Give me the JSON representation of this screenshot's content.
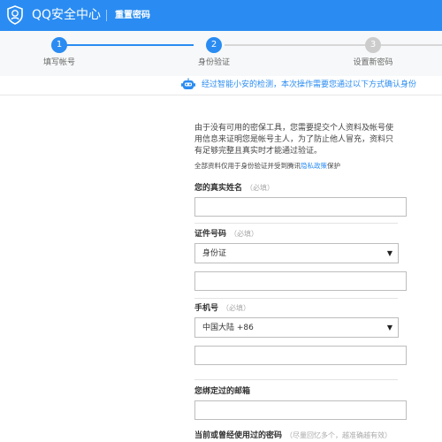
{
  "header": {
    "app_title": "QQ安全中心",
    "subtitle": "重置密码"
  },
  "steps": [
    {
      "number": "1",
      "label": "填写帐号",
      "state": "done"
    },
    {
      "number": "2",
      "label": "身份验证",
      "state": "current"
    },
    {
      "number": "3",
      "label": "设置新密码",
      "state": "todo"
    }
  ],
  "notice": {
    "icon": "robot-icon",
    "text": "经过智能小安的检测，本次操作需要您通过以下方式确认身份"
  },
  "intro": {
    "text": "由于没有可用的密保工具，您需要提交个人资料及帐号使用信息来证明您是帐号主人，为了防止他人冒充，资料只有足够完整且真实时才能通过验证。",
    "privacy_prefix": "全部资料仅用于身份验证并受到腾讯",
    "privacy_link": "隐私政策",
    "privacy_suffix": "保护"
  },
  "form": {
    "name": {
      "label": "您的真实姓名",
      "hint": "（必填）",
      "value": ""
    },
    "id": {
      "label": "证件号码",
      "hint": "（必填）",
      "type_value": "身份证",
      "number_value": ""
    },
    "phone": {
      "label": "手机号",
      "hint": "（必填）",
      "region_value": "中国大陆 +86",
      "number_value": ""
    },
    "email": {
      "label": "您绑定过的邮箱",
      "value": ""
    },
    "password": {
      "label": "当前或曾经使用过的密码",
      "hint": "（尽量回忆多个，越准确越有效）"
    }
  },
  "colors": {
    "accent": "#2a8cf2",
    "inactive": "#cccccc"
  }
}
